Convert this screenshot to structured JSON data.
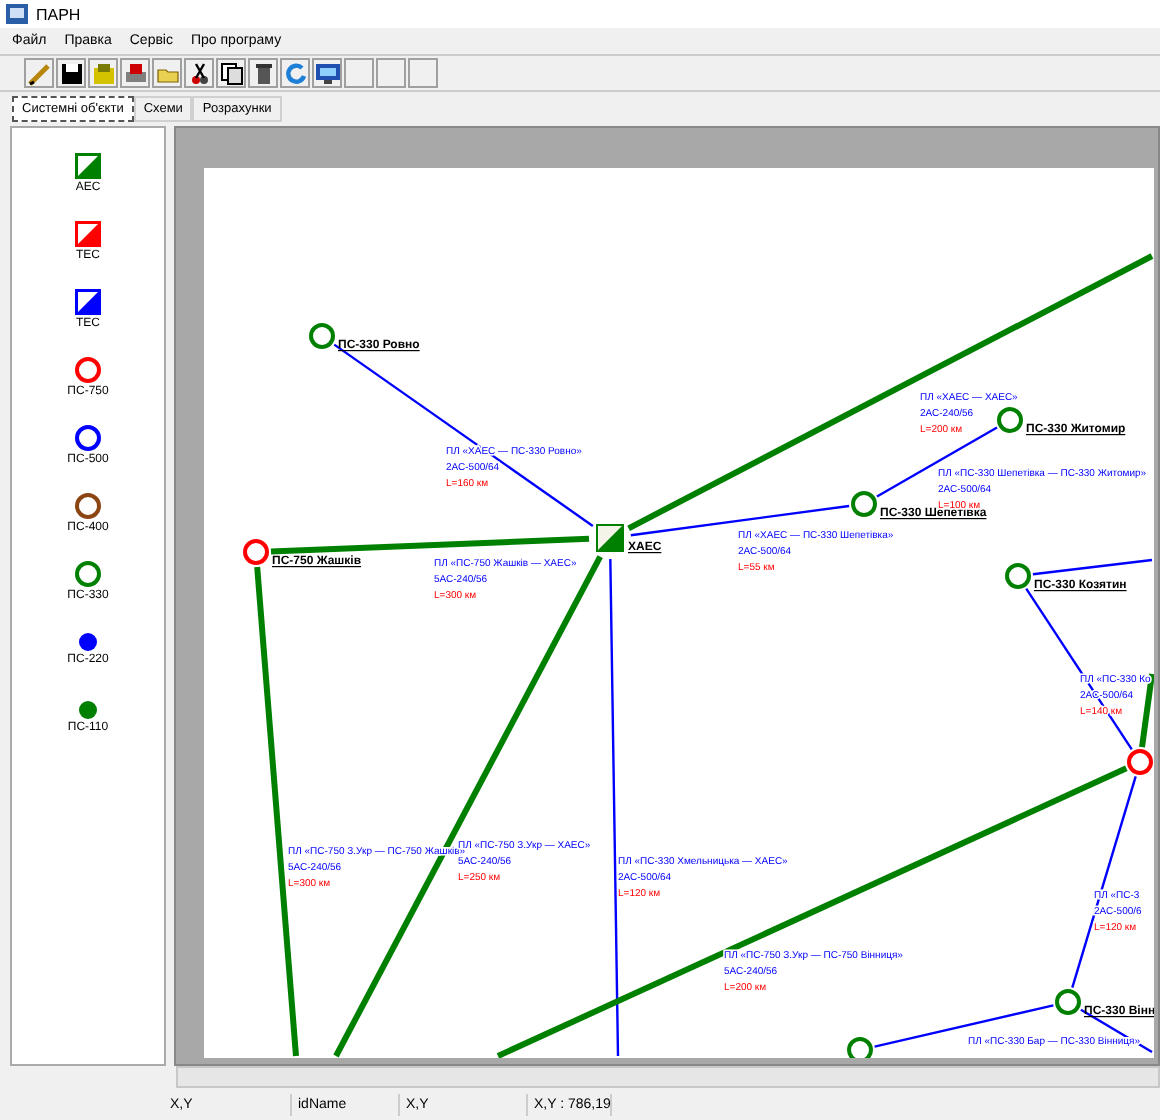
{
  "window": {
    "title": "ПАРН"
  },
  "menu": [
    "Файл",
    "Правка",
    "Сервіс",
    "Про програму"
  ],
  "tabs": [
    {
      "label": "Системні об'єкти",
      "selected": true
    },
    {
      "label": "Схеми",
      "selected": false
    },
    {
      "label": "Розрахунки",
      "selected": false
    }
  ],
  "palette": [
    {
      "label": "АЕС",
      "kind": "square",
      "color": "#008000"
    },
    {
      "label": "ТЕС",
      "kind": "square",
      "color": "#ff0000"
    },
    {
      "label": "ТЕС",
      "kind": "square",
      "color": "#0000ff"
    },
    {
      "label": "ПС-750",
      "kind": "ring",
      "color": "#ff0000"
    },
    {
      "label": "ПС-500",
      "kind": "ring",
      "color": "#0000ff"
    },
    {
      "label": "ПС-400",
      "kind": "ring",
      "color": "#8b4513"
    },
    {
      "label": "ПС-330",
      "kind": "ring",
      "color": "#008000"
    },
    {
      "label": "ПС-220",
      "kind": "dot",
      "color": "#0000ff"
    },
    {
      "label": "ПС-110",
      "kind": "dot",
      "color": "#008000"
    }
  ],
  "nodes": [
    {
      "label": "ПС-330 Ровно",
      "kind": "ring",
      "color": "#008000"
    },
    {
      "label": "ХАЕС",
      "kind": "square",
      "color": "#008000"
    },
    {
      "label": "ПС-750 Жашків",
      "kind": "ring",
      "color": "#ff0000"
    },
    {
      "label": "ПС-330 Шепетівка",
      "kind": "ring",
      "color": "#008000"
    },
    {
      "label": "ПС-330 Житомир",
      "kind": "ring",
      "color": "#008000"
    },
    {
      "label": "ПС-330 Козятин",
      "kind": "ring",
      "color": "#008000"
    },
    {
      "kind": "ring",
      "color": "#ff0000"
    },
    {
      "label": "ПС-330 Вінн",
      "kind": "ring",
      "color": "#008000"
    },
    {
      "kind": "ring",
      "color": "#008000"
    }
  ],
  "lines": [
    {
      "color": "#008000",
      "label": {
        "name": "ПЛ «ХАЕС — ХАЕС»",
        "wire": "2АС-240/56",
        "length": "L=200 км"
      }
    },
    {
      "color": "#0000ff",
      "label": {
        "name": "ПЛ «ХАЕС — ПС-330 Ровно»",
        "wire": "2АС-500/64",
        "length": "L=160 км"
      }
    },
    {
      "color": "#008000",
      "label": {
        "name": "ПЛ «ПС-750 Жашків — ХАЕС»",
        "wire": "5АС-240/56",
        "length": "L=300 км"
      }
    },
    {
      "color": "#0000ff",
      "label": {
        "name": "ПЛ «ХАЕС — ПС-330 Шепетівка»",
        "wire": "2АС-500/64",
        "length": "L=55 км"
      }
    },
    {
      "color": "#0000ff",
      "label": {
        "name": "ПЛ «ПС-330 Шепетівка — ПС-330 Житомир»",
        "wire": "2АС-500/64",
        "length": "L=100 км"
      }
    },
    {
      "color": "#008000",
      "label": {
        "name": "ПЛ «ПС-750 З.Укр — ПС-750 Жашків»",
        "wire": "5АС-240/56",
        "length": "L=300 км"
      }
    },
    {
      "color": "#008000",
      "label": {
        "name": "ПЛ «ПС-750 З.Укр — ХАЕС»",
        "wire": "5АС-240/56",
        "length": "L=250 км"
      }
    },
    {
      "color": "#0000ff",
      "label": {
        "name": "ПЛ «ПС-330 Хмельницька — ХАЕС»",
        "wire": "2АС-500/64",
        "length": "L=120 км"
      }
    },
    {
      "color": "#008000",
      "label": {
        "name": "ПЛ «ПС-750 З.Укр — ПС-750 Вінниця»",
        "wire": "5АС-240/56",
        "length": "L=200 км"
      }
    },
    {
      "color": "#008000"
    },
    {
      "color": "#0000ff",
      "label": {
        "name": "ПЛ «ПС-330 Ко",
        "wire": "2АС-500/64",
        "length": "L=140 км"
      }
    },
    {
      "color": "#0000ff"
    },
    {
      "color": "#0000ff",
      "label": {
        "name": "ПЛ «ПС-3",
        "wire": "2АС-500/6",
        "length": "L=120 км"
      }
    },
    {
      "color": "#0000ff",
      "label": {
        "name": "ПЛ «ПС-330 Бар — ПС-330 Вінниця»"
      }
    },
    {
      "color": "#0000ff"
    }
  ],
  "status_bar": [
    "X,Y",
    "idName",
    "X,Y",
    "X,Y : 786,19"
  ]
}
